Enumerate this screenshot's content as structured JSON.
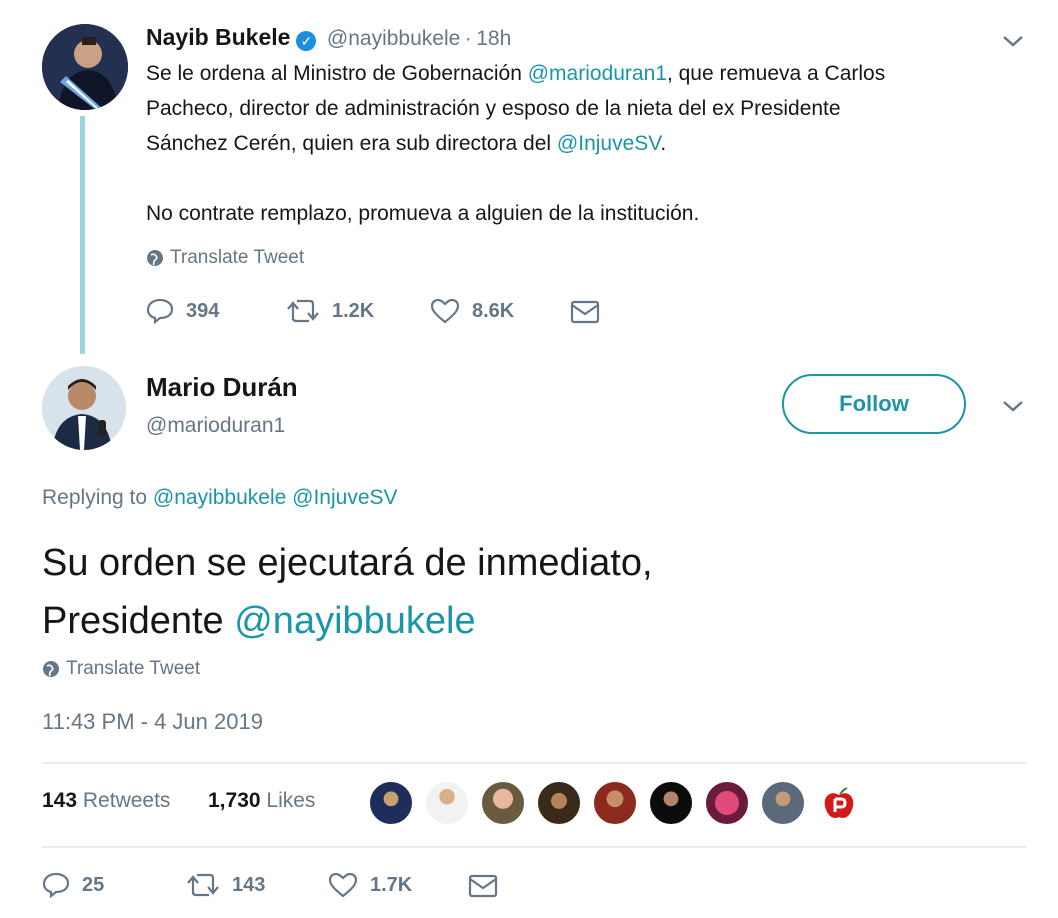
{
  "first_tweet": {
    "author_name": "Nayib Bukele",
    "handle": "@nayibbukele",
    "separator": "·",
    "time": "18h",
    "line1_prefix": "Se le ordena al Ministro de Gobernación ",
    "line1_mention": "@marioduran1",
    "line1_suffix": ", que remueva a Carlos",
    "line2": "Pacheco, director de administración y esposo de la nieta del ex Presidente",
    "line3_prefix": "Sánchez Cerén, quien era sub directora del ",
    "line3_mention": "@InjuveSV",
    "line3_suffix": ".",
    "line4": "No contrate remplazo, promueva a alguien de la institución.",
    "translate": "Translate Tweet",
    "replies": "394",
    "retweets": "1.2K",
    "likes": "8.6K"
  },
  "reply_tweet": {
    "author_name": "Mario Durán",
    "handle": "@marioduran1",
    "follow_label": "Follow",
    "replying_label": "Replying to",
    "replying_mention1": "@nayibbukele",
    "replying_mention2": "@InjuveSV",
    "text_line1": "Su orden se ejecutará de inmediato,",
    "text_line2_prefix": "Presidente ",
    "text_line2_mention": "@nayibbukele",
    "translate": "Translate Tweet",
    "timestamp": "11:43 PM - 4 Jun 2019",
    "retweet_count": "143",
    "retweet_label": "Retweets",
    "like_count": "1,730",
    "like_label": "Likes",
    "replies": "25",
    "retweets": "143",
    "likes": "1.7K"
  },
  "colors": {
    "link": "#1b95a8",
    "thread_line": "#9ed3df",
    "verified": "#1d8fe0"
  }
}
